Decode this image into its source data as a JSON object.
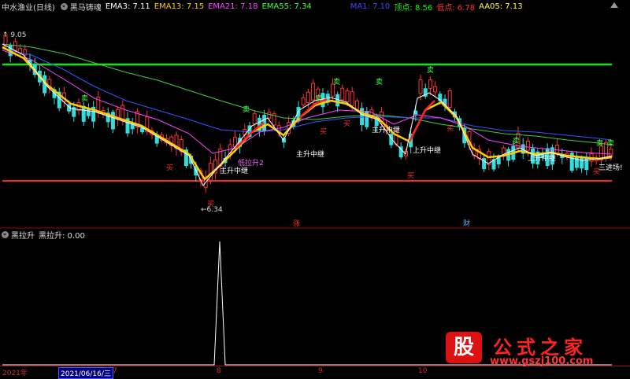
{
  "header": {
    "stock_title": "中水渔业(日线)",
    "indicator_name": "黑马铸魂",
    "ema3": "EMA3: 7.11",
    "ema13": "EMA13: 7.15",
    "ema21": "EMA21: 7.18",
    "ema55": "EMA55: 7.34",
    "ma1": "MA1: 7.10",
    "top_point": "顶点: 8.56",
    "low_point": "低点: 6.78",
    "aa05": "AA05: 7.13"
  },
  "sub_header": {
    "title": "黑拉升",
    "value": "黑拉升: 0.00"
  },
  "price_labels": {
    "high": "9.05",
    "low": "6.34"
  },
  "signals": {
    "buy": "买",
    "sell": "卖",
    "rise_relay": "上升中继",
    "main_rise_relay": "主升中继",
    "low_pull": "低拉升2",
    "enter": "三进场!"
  },
  "markers": {
    "rise": "涨",
    "fin": "财"
  },
  "axis": {
    "year": "2021年",
    "date": "2021/06/16/三",
    "m7": "7",
    "m8": "8",
    "m9": "9",
    "m10": "10"
  },
  "watermark": {
    "brand": "股",
    "text": "公式之家",
    "url": "www.gszj100.com"
  },
  "colors": {
    "ema3": "#ffffff",
    "ema13": "#ffcc00",
    "ema21": "#ff44ff",
    "ema55": "#44ff44",
    "ma1": "#4444ff",
    "top": "#00ff00",
    "bottom": "#ff2222"
  }
}
